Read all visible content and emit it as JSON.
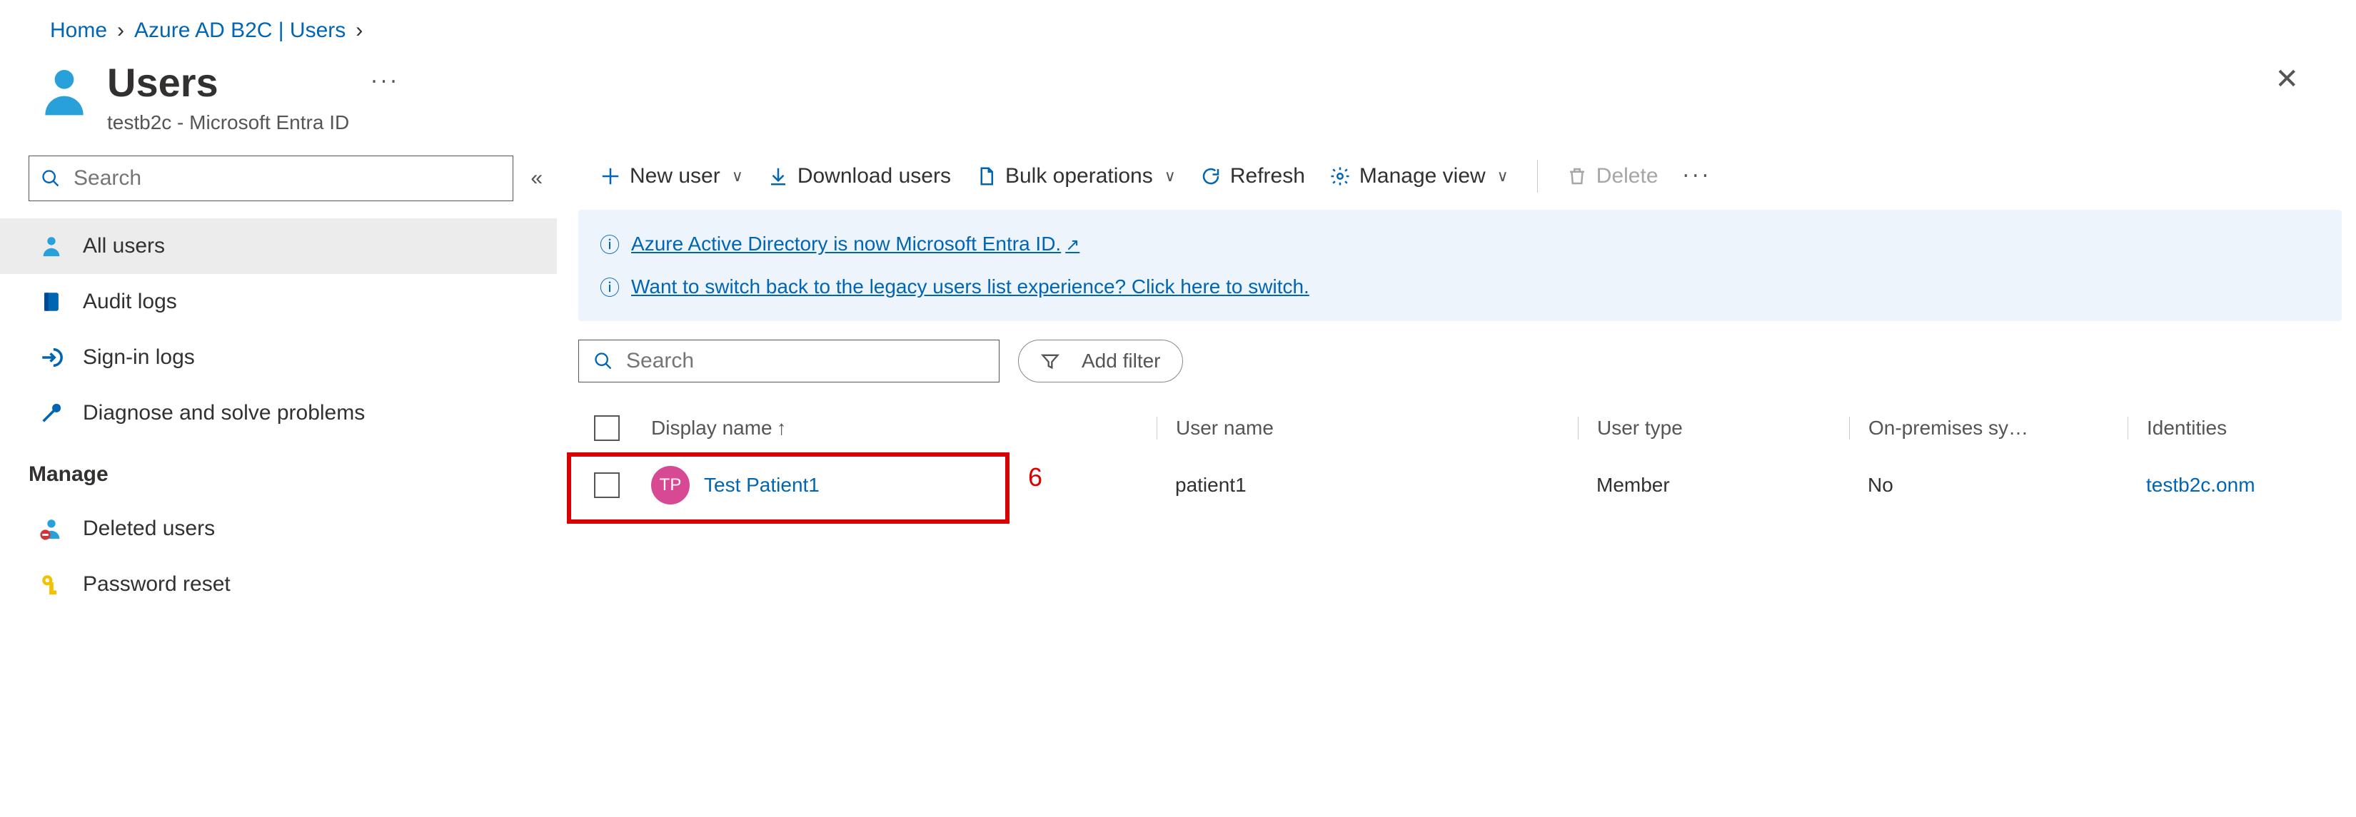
{
  "breadcrumb": {
    "home": "Home",
    "section": "Azure AD B2C | Users"
  },
  "header": {
    "title": "Users",
    "subtitle": "testb2c - Microsoft Entra ID"
  },
  "sidebar": {
    "search_placeholder": "Search",
    "items": {
      "all_users": "All users",
      "audit_logs": "Audit logs",
      "signin_logs": "Sign-in logs",
      "diagnose": "Diagnose and solve problems"
    },
    "manage_header": "Manage",
    "manage_items": {
      "deleted_users": "Deleted users",
      "password_reset": "Password reset"
    }
  },
  "toolbar": {
    "new_user": "New user",
    "download_users": "Download users",
    "bulk_ops": "Bulk operations",
    "refresh": "Refresh",
    "manage_view": "Manage view",
    "delete": "Delete"
  },
  "infobar": {
    "line1": "Azure Active Directory is now Microsoft Entra ID.",
    "line2": "Want to switch back to the legacy users list experience? Click here to switch."
  },
  "filter": {
    "search_placeholder": "Search",
    "add_filter": "Add filter"
  },
  "table": {
    "columns": {
      "display_name": "Display name",
      "user_name": "User name",
      "user_type": "User type",
      "on_prem": "On-premises sy…",
      "identities": "Identities"
    },
    "rows": [
      {
        "avatar_initials": "TP",
        "display_name": "Test Patient1",
        "user_name": "patient1",
        "user_type": "Member",
        "on_prem": "No",
        "identities": "testb2c.onm"
      }
    ]
  },
  "annotation": {
    "number": "6"
  }
}
